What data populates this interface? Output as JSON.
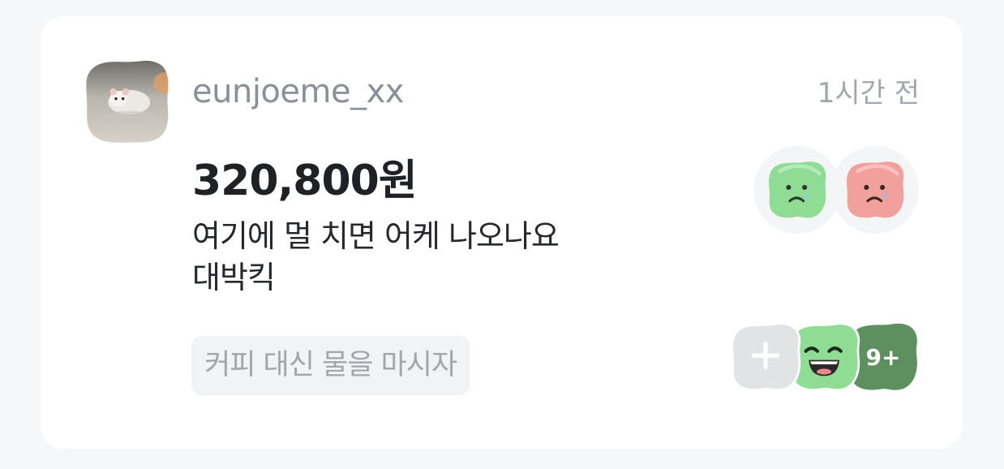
{
  "post": {
    "username": "eunjoeme_xx",
    "time_ago": "1시간 전",
    "amount": "320,800원",
    "memo_line1": "여기에 멀 치면 어케 나오나요",
    "memo_line2": "대박킥",
    "tag": "커피 대신 물을 마시자"
  },
  "avatar": {
    "icon": "hamster-photo"
  },
  "quick_reactions": [
    {
      "icon": "sad-green-face-icon",
      "color": "#8fdc94"
    },
    {
      "icon": "sad-red-face-icon",
      "color": "#f2a09d"
    }
  ],
  "reactions": {
    "add_icon": "plus-icon",
    "laughing_icon": "laughing-green-face-icon",
    "more_count": "9+",
    "colors": {
      "add": "#e2e3e5",
      "laugh": "#8fdc94",
      "more": "#5e8f5e"
    }
  }
}
